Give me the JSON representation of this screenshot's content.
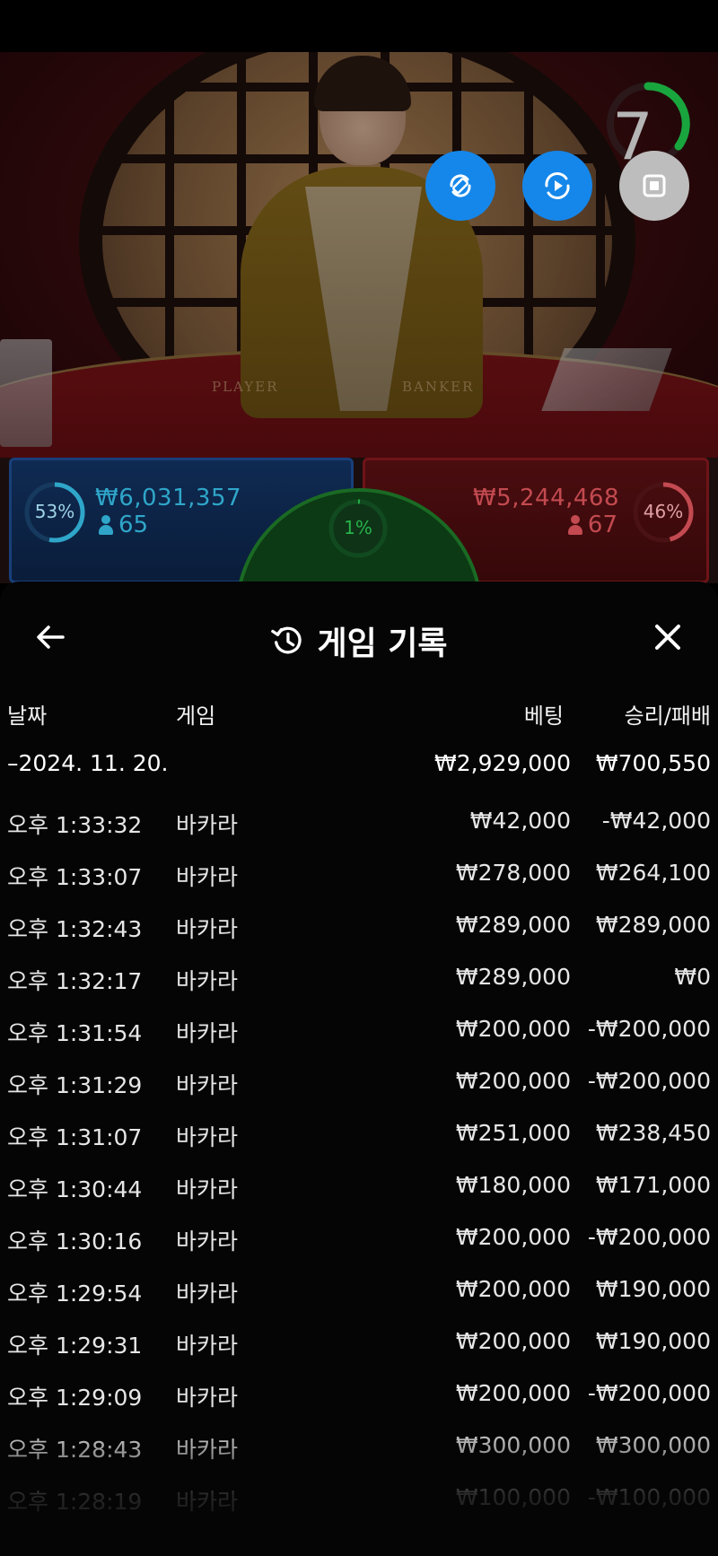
{
  "video": {
    "table_label_player": "PLAYER",
    "table_label_banker": "BANKER",
    "countdown": "7"
  },
  "stats": {
    "player": {
      "percent": "53%",
      "percent_value": 53,
      "amount": "₩6,031,357",
      "bettors": "65",
      "color": "#2fa6c9"
    },
    "tie": {
      "percent": "1%",
      "percent_value": 1,
      "color": "#27b34a"
    },
    "banker": {
      "percent": "46%",
      "percent_value": 46,
      "amount": "₩5,244,468",
      "bettors": "67",
      "color": "#c24a50"
    }
  },
  "history": {
    "title": "게임 기록",
    "columns": {
      "date": "날짜",
      "game": "게임",
      "bet": "베팅",
      "result": "승리/패배"
    },
    "summary": {
      "date": "–2024. 11. 20.",
      "bet": "₩2,929,000",
      "result": "₩700,550"
    },
    "rows": [
      {
        "time": "오후 1:33:32",
        "game": "바카라",
        "bet": "₩42,000",
        "result": "-₩42,000"
      },
      {
        "time": "오후 1:33:07",
        "game": "바카라",
        "bet": "₩278,000",
        "result": "₩264,100"
      },
      {
        "time": "오후 1:32:43",
        "game": "바카라",
        "bet": "₩289,000",
        "result": "₩289,000"
      },
      {
        "time": "오후 1:32:17",
        "game": "바카라",
        "bet": "₩289,000",
        "result": "₩0"
      },
      {
        "time": "오후 1:31:54",
        "game": "바카라",
        "bet": "₩200,000",
        "result": "-₩200,000"
      },
      {
        "time": "오후 1:31:29",
        "game": "바카라",
        "bet": "₩200,000",
        "result": "-₩200,000"
      },
      {
        "time": "오후 1:31:07",
        "game": "바카라",
        "bet": "₩251,000",
        "result": "₩238,450"
      },
      {
        "time": "오후 1:30:44",
        "game": "바카라",
        "bet": "₩180,000",
        "result": "₩171,000"
      },
      {
        "time": "오후 1:30:16",
        "game": "바카라",
        "bet": "₩200,000",
        "result": "-₩200,000"
      },
      {
        "time": "오후 1:29:54",
        "game": "바카라",
        "bet": "₩200,000",
        "result": "₩190,000"
      },
      {
        "time": "오후 1:29:31",
        "game": "바카라",
        "bet": "₩200,000",
        "result": "₩190,000"
      },
      {
        "time": "오후 1:29:09",
        "game": "바카라",
        "bet": "₩200,000",
        "result": "-₩200,000"
      },
      {
        "time": "오후 1:28:43",
        "game": "바카라",
        "bet": "₩300,000",
        "result": "₩300,000"
      },
      {
        "time": "오후 1:28:19",
        "game": "바카라",
        "bet": "₩100,000",
        "result": "-₩100,000"
      }
    ]
  },
  "icons": {
    "back": "arrow-left-icon",
    "history": "history-clock-icon",
    "close": "close-icon",
    "rotate": "rotate-screen-icon",
    "video": "video-refresh-icon",
    "stop": "stop-icon"
  }
}
